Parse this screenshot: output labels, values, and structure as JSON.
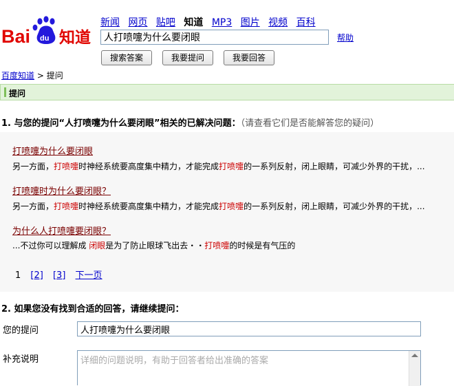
{
  "logo": {
    "text": "Baidu知道",
    "du": "du"
  },
  "nav": [
    "新闻",
    "网页",
    "贴吧",
    "知道",
    "MP3",
    "图片",
    "视频",
    "百科"
  ],
  "nav_current": "知道",
  "search": {
    "value": "人打喷嚏为什么要闭眼"
  },
  "help": "帮助",
  "buttons": {
    "search": "搜索答案",
    "ask": "我要提问",
    "answer": "我要回答"
  },
  "breadcrumb": {
    "home": "百度知道",
    "sep": " > ",
    "current": "提问"
  },
  "section_bar": "提问",
  "q1": {
    "prefix": "1. 与您的提问“人打喷嚏为什么要闭眼”相关的已解决问题：",
    "hint": "（请查看它们是否能解答您的疑问）"
  },
  "results": [
    {
      "title": "打喷嚏为什么要闭眼",
      "snippet": [
        [
          "另一方面，",
          false
        ],
        [
          "打喷嚏",
          true
        ],
        [
          "时神经系统要高度集中精力，才能完成",
          false
        ],
        [
          "打喷嚏",
          true
        ],
        [
          "的一系列反射，闭上眼睛，可减少外界的干扰，",
          false
        ],
        [
          "...",
          false
        ]
      ]
    },
    {
      "title": "打喷嚏时为什么要闭眼？",
      "snippet": [
        [
          "另一方面，",
          false
        ],
        [
          "打喷嚏",
          true
        ],
        [
          "时神经系统要高度集中精力，才能完成",
          false
        ],
        [
          "打喷嚏",
          true
        ],
        [
          "的一系列反射，闭上眼睛，可减少外界的干扰，",
          false
        ],
        [
          "...",
          false
        ]
      ]
    },
    {
      "title": "为什么人打喷嚏要闭眼？",
      "snippet": [
        [
          "...不过你可以理解成 ",
          false
        ],
        [
          "闭眼",
          true
        ],
        [
          "是为了防止眼球飞出去・・",
          false
        ],
        [
          "打喷嚏",
          true
        ],
        [
          "的时候是有气压的",
          false
        ]
      ]
    }
  ],
  "pager": {
    "current": "1",
    "pages": [
      "[2]",
      "[3]"
    ],
    "next": "下一页"
  },
  "q2": "2. 如果您没有找到合适的回答，请继续提问：",
  "form": {
    "question_label": "您的提问",
    "question_value": "人打喷嚏为什么要闭眼",
    "desc_label": "补充说明",
    "desc_placeholder": "详细的问题说明，有助于回答者给出准确的答案"
  },
  "colors": {
    "link": "#0000cc",
    "title_link": "#7a0000",
    "highlight": "#cc0000",
    "bar_bg": "#e2f3da"
  }
}
